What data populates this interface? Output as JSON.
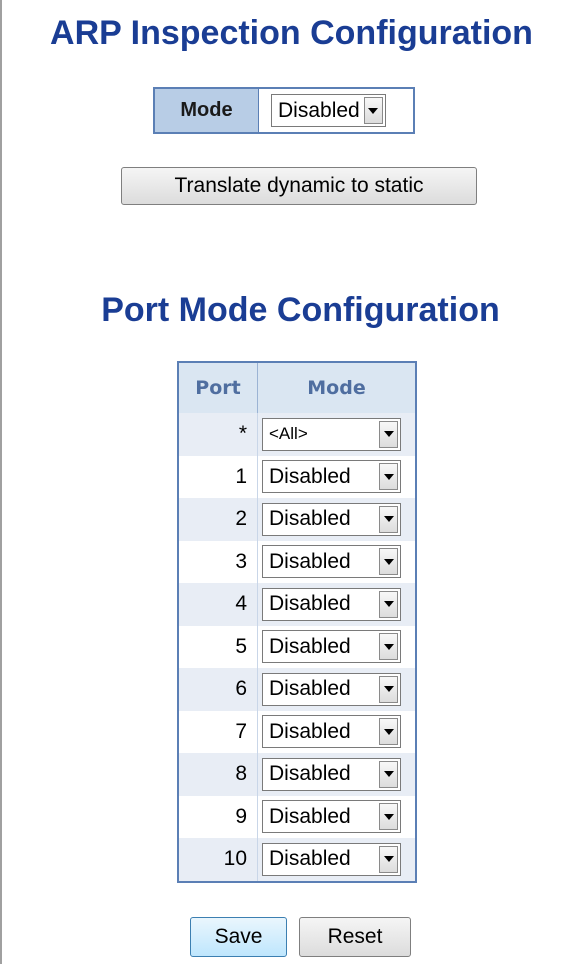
{
  "page": {
    "title": "ARP Inspection Configuration",
    "mode_label": "Mode",
    "mode_value": "Disabled",
    "translate_button": "Translate dynamic to static"
  },
  "port_mode": {
    "title": "Port Mode Configuration",
    "headers": {
      "port": "Port",
      "mode": "Mode"
    },
    "rows": [
      {
        "port": "*",
        "mode": "<All>"
      },
      {
        "port": "1",
        "mode": "Disabled"
      },
      {
        "port": "2",
        "mode": "Disabled"
      },
      {
        "port": "3",
        "mode": "Disabled"
      },
      {
        "port": "4",
        "mode": "Disabled"
      },
      {
        "port": "5",
        "mode": "Disabled"
      },
      {
        "port": "6",
        "mode": "Disabled"
      },
      {
        "port": "7",
        "mode": "Disabled"
      },
      {
        "port": "8",
        "mode": "Disabled"
      },
      {
        "port": "9",
        "mode": "Disabled"
      },
      {
        "port": "10",
        "mode": "Disabled"
      }
    ]
  },
  "actions": {
    "save": "Save",
    "reset": "Reset"
  },
  "colors": {
    "heading": "#1a3d94",
    "table_border": "#5b7fb5",
    "header_bg": "#dae6f2",
    "row_alt_bg": "#e8edf5",
    "mode_label_bg": "#b8cde6"
  },
  "icons": {
    "dropdown": "chevron-down-icon"
  }
}
